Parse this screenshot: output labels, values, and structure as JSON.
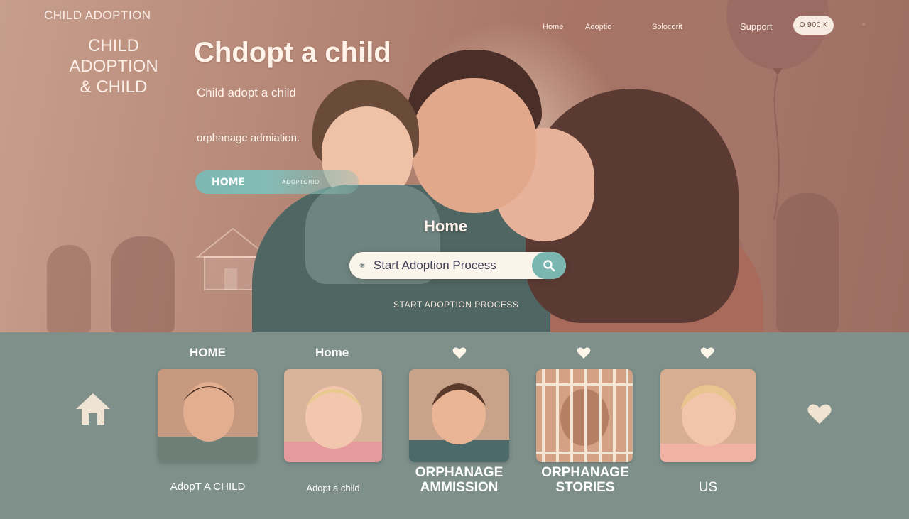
{
  "brand": {
    "small": "CHILD ADOPTION",
    "big_line1": "CHILD",
    "big_line2": "ADOPTION",
    "big_line3": "& CHILD"
  },
  "nav": {
    "items": [
      "Home",
      "Adoptio",
      "Solocorit",
      "Support"
    ],
    "button": "O 900 K"
  },
  "hero": {
    "title": "Chdopt a child",
    "subtitle": "Child adopt a child",
    "subtitle2": "orphanage admiation.",
    "pill_home": "HOME",
    "pill_adopt": "ADOPTORIO",
    "center_label": "Home",
    "search_value": "Start Adoption Process",
    "caption": "START ADOPTION PROCESS"
  },
  "strip": {
    "headings": [
      "HOME",
      "Home"
    ]
  },
  "cards": [
    {
      "label_line1": "AdopT A CHILD",
      "label_line2": ""
    },
    {
      "label_line1": "Adopt a child",
      "label_line2": ""
    },
    {
      "label_line1": "ORPHANAGE",
      "label_line2": "AMMISSION"
    },
    {
      "label_line1": "ORPHANAGE",
      "label_line2": "STORIES"
    },
    {
      "label_line1": "US",
      "label_line2": ""
    }
  ],
  "colors": {
    "hero_bg": "#b48575",
    "accent_teal": "#7ab7b1",
    "strip_bg": "#7f908b",
    "cream": "#fbf4ea"
  }
}
